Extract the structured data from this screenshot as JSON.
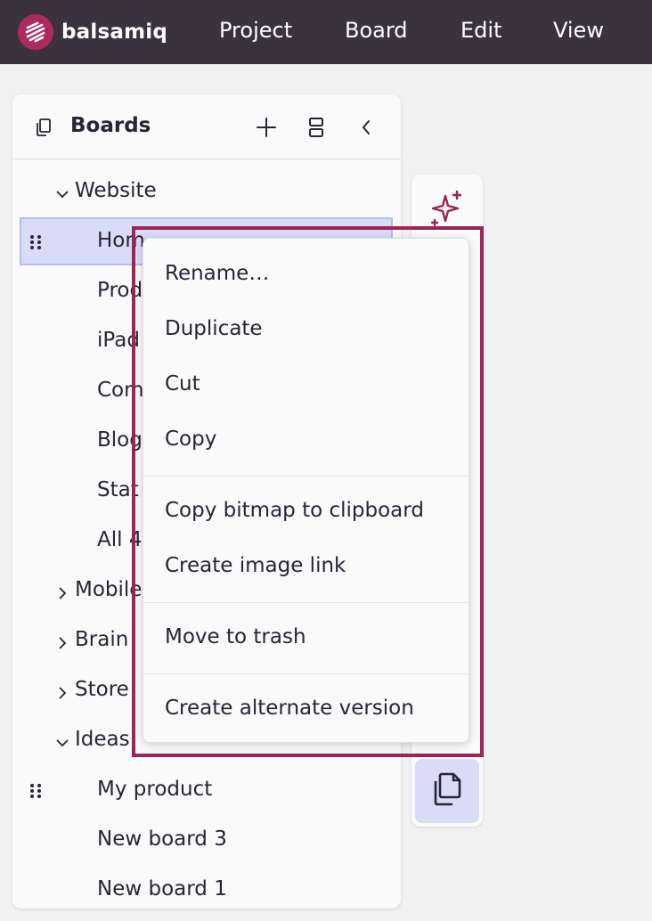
{
  "app": {
    "brand": "balsamiq",
    "accent": "#ac2b5f"
  },
  "menubar": {
    "items": [
      "Project",
      "Board",
      "Edit",
      "View"
    ]
  },
  "panel": {
    "title": "Boards",
    "icons": [
      "boards-icon",
      "plus-icon",
      "split-icon",
      "chevron-left-icon"
    ]
  },
  "tree": {
    "website": "Website",
    "home": "Hom",
    "prod": "Prod",
    "ipad": "iPad",
    "com": "Com",
    "blog": "Blog",
    "stat": "Stat",
    "all": "All 4",
    "mobile": "Mobile",
    "brain": "Brain",
    "store": "Store",
    "ideas": "Ideas",
    "my_product": "My product",
    "new_board_3": "New board 3",
    "new_board_1": "New board 1"
  },
  "context_menu": {
    "rename": "Rename…",
    "duplicate": "Duplicate",
    "cut": "Cut",
    "copy": "Copy",
    "copy_bitmap": "Copy bitmap to clipboard",
    "image_link": "Create image link",
    "trash": "Move to trash",
    "alternate": "Create alternate version"
  }
}
